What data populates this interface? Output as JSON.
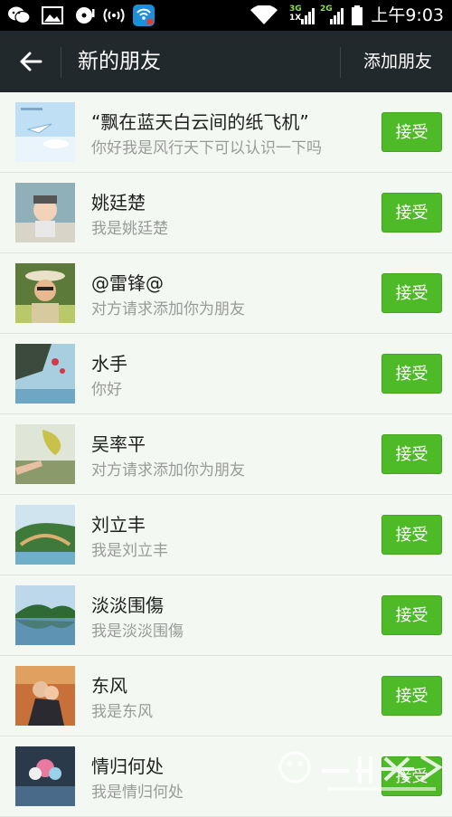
{
  "status_bar": {
    "time": "上午9:03",
    "net_a_top": "3G",
    "net_a_bottom": "1X",
    "net_b_top": "2G",
    "icons": [
      "wechat-icon",
      "image-icon",
      "music-disc-icon",
      "wifi-hotspot-icon",
      "wifi-app-icon",
      "wifi-icon",
      "signal-icon",
      "battery-icon"
    ]
  },
  "header": {
    "title": "新的朋友",
    "add_friend_label": "添加朋友",
    "back_icon": "back-arrow-icon"
  },
  "accept_label": "接受",
  "requests": [
    {
      "name": "“飘在蓝天白云间的纸飞机”",
      "message": "你好我是风行天下可以认识一下吗"
    },
    {
      "name": "姚廷楚",
      "message": "我是姚廷楚"
    },
    {
      "name": "@雷锋@",
      "message": "对方请求添加你为朋友"
    },
    {
      "name": "水手",
      "message": "你好"
    },
    {
      "name": "吴率平",
      "message": "对方请求添加你为朋友"
    },
    {
      "name": "刘立丰",
      "message": "我是刘立丰"
    },
    {
      "name": "淡淡围傷",
      "message": "我是淡淡围傷"
    },
    {
      "name": "东风",
      "message": "我是东风"
    },
    {
      "name": "情归何处",
      "message": "我是情归何处"
    }
  ],
  "colors": {
    "accept_button": "#4fba27",
    "header_bg": "#22292c",
    "list_bg": "#f3f8f2"
  }
}
